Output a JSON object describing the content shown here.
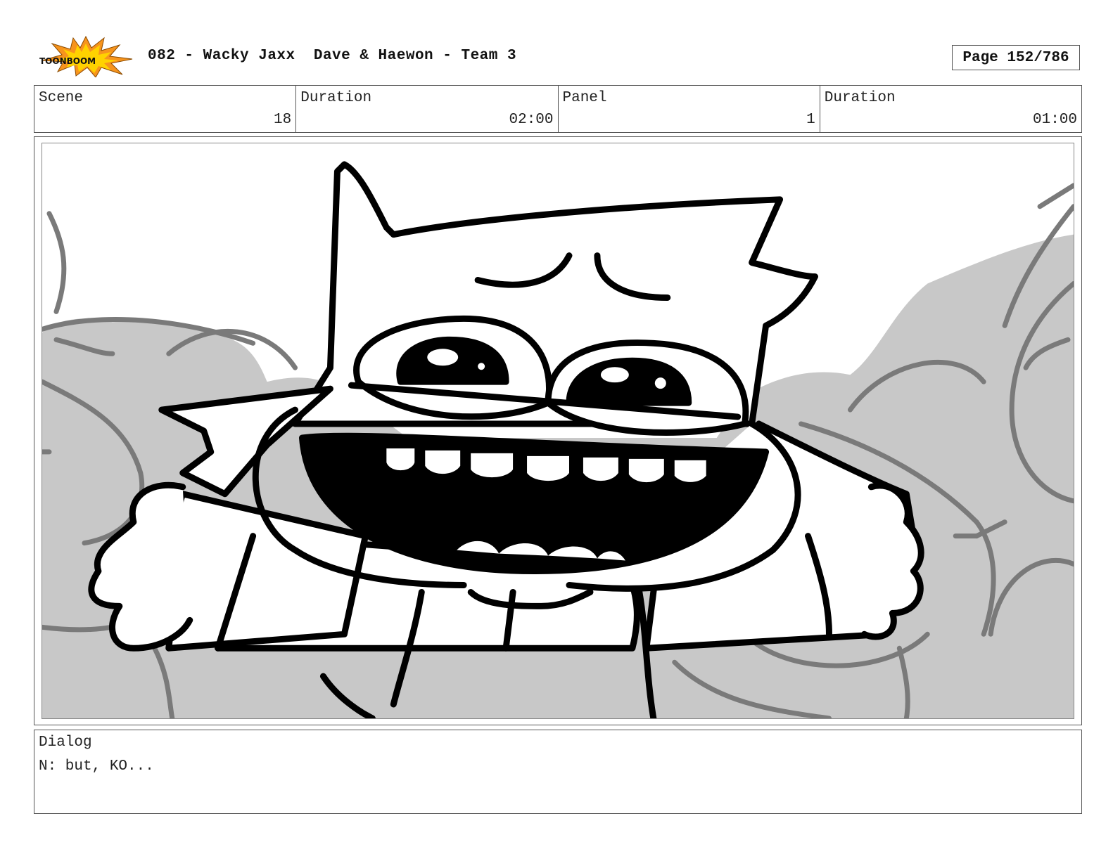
{
  "header": {
    "logo_text": "TOONBOOM",
    "title": "082 - Wacky Jaxx  Dave & Haewon - Team 3",
    "page_label": "Page 152/786"
  },
  "info": {
    "scene_label": "Scene",
    "scene_value": "18",
    "scene_duration_label": "Duration",
    "scene_duration_value": "02:00",
    "panel_label": "Panel",
    "panel_value": "1",
    "panel_duration_label": "Duration",
    "panel_duration_value": "01:00"
  },
  "dialog": {
    "label": "Dialog",
    "text": "N: but, KO..."
  },
  "colors": {
    "logo_orange": "#f7941d",
    "logo_yellow": "#ffd200",
    "background_gray": "#c8c8c8",
    "crowd_line_gray": "#7a7a7a",
    "ink": "#000000"
  }
}
